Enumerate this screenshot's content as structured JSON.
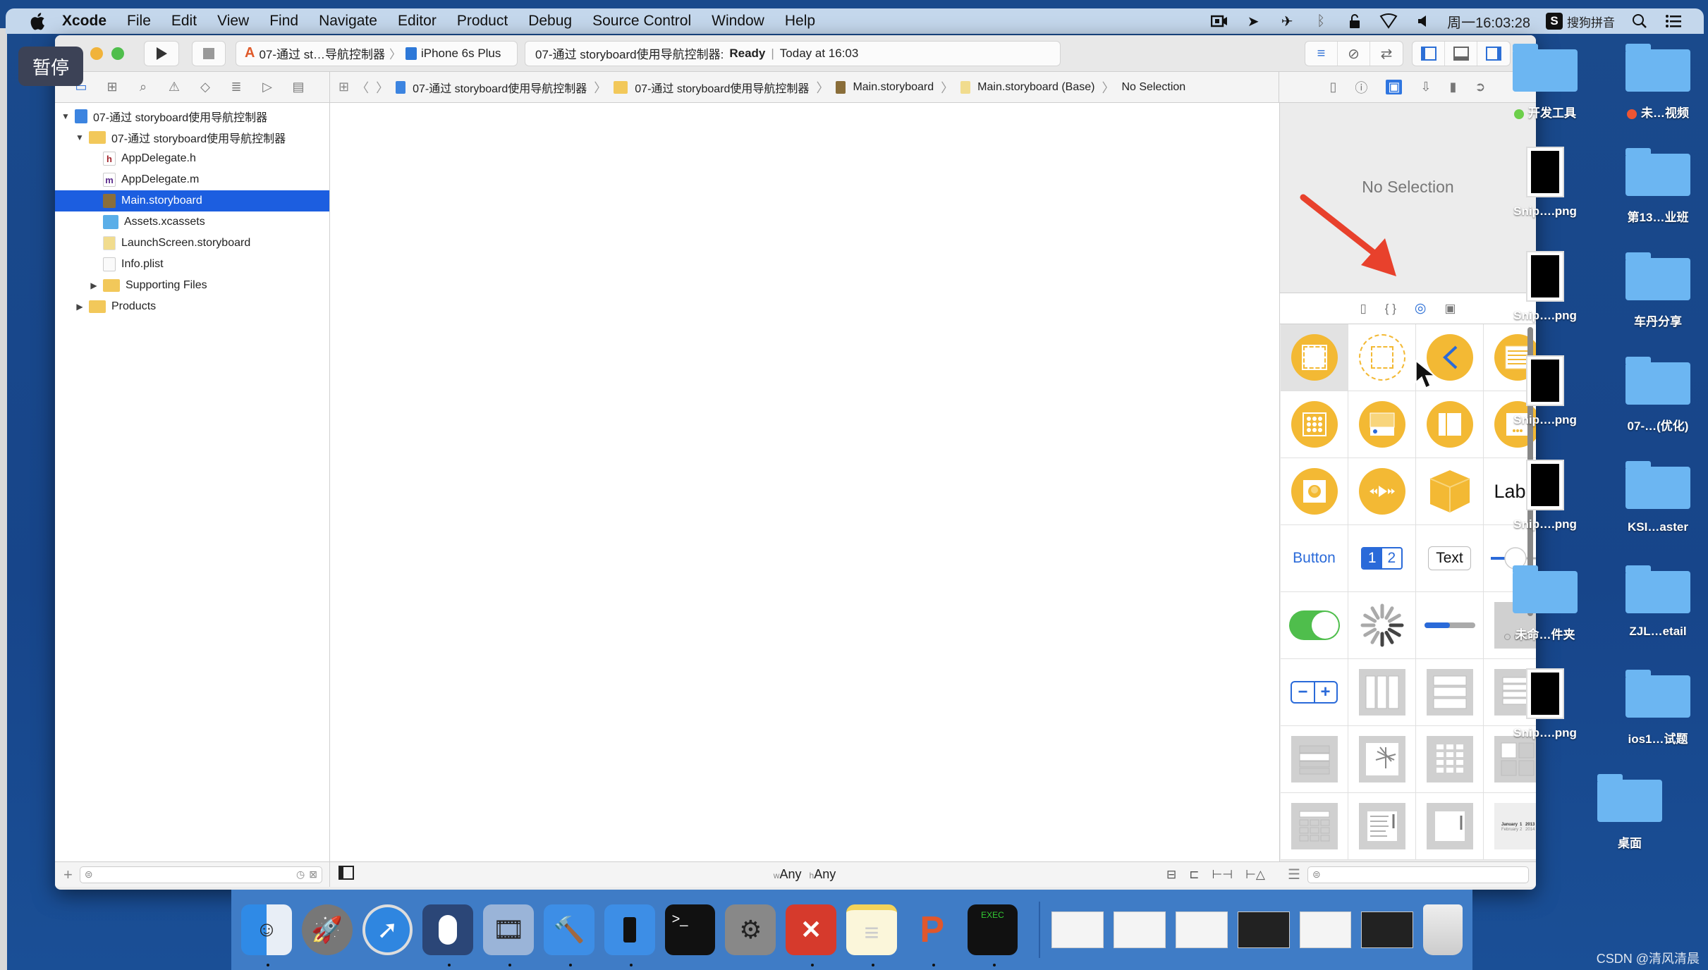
{
  "menubar": {
    "app": "Xcode",
    "items": [
      "File",
      "Edit",
      "View",
      "Find",
      "Navigate",
      "Editor",
      "Product",
      "Debug",
      "Source Control",
      "Window",
      "Help"
    ],
    "clock": "周一16:03:28",
    "ime_label": "搜狗拼音",
    "ime_badge": "S",
    "status_icons": [
      "screen-record-icon",
      "location-icon",
      "airplane-icon",
      "bluetooth-icon",
      "lock-icon",
      "wifi-icon",
      "volume-icon"
    ]
  },
  "overlay": {
    "pause_label": "暂停"
  },
  "toolbar": {
    "scheme": "07-通过 st…导航控制器",
    "device": "iPhone 6s Plus",
    "status_project": "07-通过 storyboard使用导航控制器:",
    "status_state": "Ready",
    "status_time": "Today at 16:03"
  },
  "jumpbar": {
    "items": [
      "07-通过 storyboard使用导航控制器",
      "07-通过 storyboard使用导航控制器",
      "Main.storyboard",
      "Main.storyboard (Base)",
      "No Selection"
    ]
  },
  "navigator": {
    "items": [
      {
        "label": "07-通过 storyboard使用导航控制器",
        "indent": 0,
        "disclosure": "open",
        "icon": "project"
      },
      {
        "label": "07-通过 storyboard使用导航控制器",
        "indent": 1,
        "disclosure": "open",
        "icon": "folder"
      },
      {
        "label": "AppDelegate.h",
        "indent": 2,
        "icon": "h"
      },
      {
        "label": "AppDelegate.m",
        "indent": 2,
        "icon": "m"
      },
      {
        "label": "Main.storyboard",
        "indent": 2,
        "icon": "storyboard",
        "selected": true
      },
      {
        "label": "Assets.xcassets",
        "indent": 2,
        "icon": "assets"
      },
      {
        "label": "LaunchScreen.storyboard",
        "indent": 2,
        "icon": "storyboard-light"
      },
      {
        "label": "Info.plist",
        "indent": 2,
        "icon": "plist"
      },
      {
        "label": "Supporting Files",
        "indent": 2,
        "disclosure": "closed",
        "icon": "folder"
      },
      {
        "label": "Products",
        "indent": 1,
        "disclosure": "closed",
        "icon": "folder"
      }
    ]
  },
  "inspector": {
    "no_selection": "No Selection"
  },
  "library": {
    "items": [
      "view-controller",
      "storyboard-reference",
      "navigation-controller",
      "table-view-controller",
      "collection-view-controller",
      "tab-bar-controller",
      "split-view-controller",
      "page-view-controller",
      "glkit-view-controller",
      "av-player-view-controller",
      "object",
      "label",
      "button",
      "segmented-control",
      "text-field",
      "slider",
      "switch",
      "activity-indicator",
      "progress-view",
      "page-control",
      "stepper",
      "stack-view-horizontal",
      "stack-view-vertical",
      "table-view",
      "table-view-cell",
      "image-view",
      "collection-view",
      "collection-view-cell",
      "collection-reusable-view",
      "text-view",
      "scroll-view",
      "date-picker"
    ],
    "label_text": "Label",
    "button_text": "Button",
    "seg_1": "1",
    "seg_2": "2",
    "textfield_text": "Text"
  },
  "bottombar": {
    "size_w": "w",
    "size_w_val": "Any",
    "size_h": "h",
    "size_h_val": "Any"
  },
  "desktop": {
    "icons": [
      {
        "label": "开发工具",
        "type": "folder",
        "tag": "#6ccf4a"
      },
      {
        "label": "未…视频",
        "type": "folder",
        "tag": "#ee5533"
      },
      {
        "label": "Snip….png",
        "type": "image"
      },
      {
        "label": "第13…业班",
        "type": "folder"
      },
      {
        "label": "Snip….png",
        "type": "image"
      },
      {
        "label": "车丹分享",
        "type": "folder"
      },
      {
        "label": "Snip….png",
        "type": "image"
      },
      {
        "label": "07-…(优化)",
        "type": "folder"
      },
      {
        "label": "Snip….png",
        "type": "image"
      },
      {
        "label": "KSI…aster",
        "type": "folder"
      },
      {
        "label": "未命…件夹",
        "type": "folder"
      },
      {
        "label": "ZJL…etail",
        "type": "folder"
      },
      {
        "label": "Snip….png",
        "type": "image"
      },
      {
        "label": "ios1…试题",
        "type": "folder"
      },
      {
        "label": "桌面",
        "type": "folder"
      }
    ],
    "watermark": "CSDN @清风清晨"
  },
  "dock": {
    "apps": [
      "finder",
      "launchpad",
      "safari",
      "mouse-app",
      "screenflow",
      "xcode",
      "simulator",
      "terminal",
      "system-preferences",
      "xmind",
      "notes",
      "powerpoint",
      "console"
    ],
    "windows": [
      "finder-window",
      "powerpoint-window",
      "xmind-window",
      "screenflow-window",
      "powerpoint-window-2",
      "screenflow-window-2"
    ],
    "trash": "trash"
  }
}
